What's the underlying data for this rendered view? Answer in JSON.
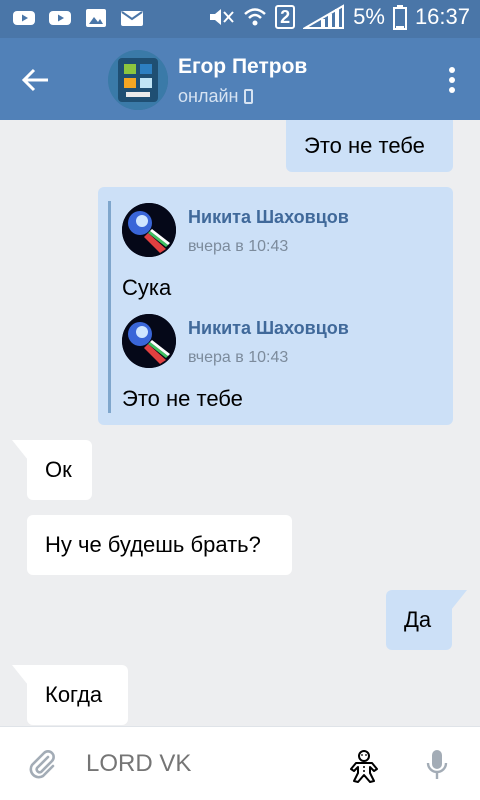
{
  "status_bar": {
    "battery_pct": "5%",
    "time": "16:37",
    "sim": "2"
  },
  "header": {
    "contact_name": "Егор Петров",
    "status": "онлайн"
  },
  "messages": [
    {
      "id": "m1",
      "dir": "out",
      "text": "Это не тебе"
    },
    {
      "id": "m2",
      "dir": "out",
      "forwarded": [
        {
          "author": "Никита Шаховцов",
          "time": "вчера в 10:43",
          "text": "Сука"
        },
        {
          "author": "Никита Шаховцов",
          "time": "вчера в 10:43",
          "text": "Это не тебе"
        }
      ]
    },
    {
      "id": "m3",
      "dir": "in",
      "text": "Ок"
    },
    {
      "id": "m4",
      "dir": "in",
      "text": "Ну че будешь брать?"
    },
    {
      "id": "m5",
      "dir": "out",
      "text": "Да"
    },
    {
      "id": "m6",
      "dir": "in",
      "text": "Когда"
    }
  ],
  "input": {
    "placeholder": "LORD VK"
  },
  "colors": {
    "header_bg": "#5181b8",
    "status_bg": "#4a76a8",
    "outgoing_bubble": "#cce0f7",
    "incoming_bubble": "#ffffff",
    "chat_bg": "#edeef0",
    "author_link": "#40699a"
  },
  "icons": [
    "youtube-icon",
    "youtube-icon",
    "image-icon",
    "mail-icon",
    "mute-icon",
    "wifi-icon",
    "signal-icon",
    "battery-icon",
    "back-arrow-icon",
    "phone-icon",
    "more-vert-icon",
    "attach-icon",
    "sticker-icon",
    "mic-icon"
  ]
}
